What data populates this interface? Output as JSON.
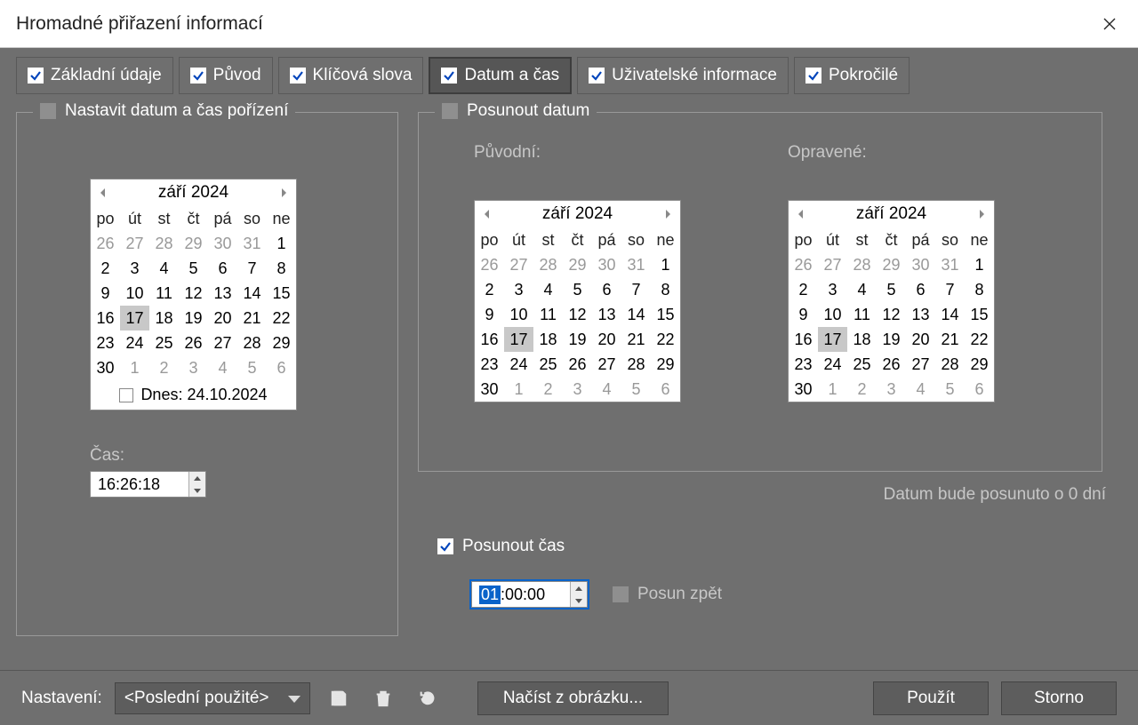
{
  "title": "Hromadné přiřazení informací",
  "tabs": [
    {
      "label": "Základní údaje",
      "checked": true,
      "active": false
    },
    {
      "label": "Původ",
      "checked": true,
      "active": false
    },
    {
      "label": "Klíčová slova",
      "checked": true,
      "active": false
    },
    {
      "label": "Datum a čas",
      "checked": true,
      "active": true
    },
    {
      "label": "Uživatelské informace",
      "checked": true,
      "active": false
    },
    {
      "label": "Pokročilé",
      "checked": true,
      "active": false
    }
  ],
  "group1": {
    "label": "Nastavit datum a čas pořízení",
    "checked": false,
    "cas_label": "Čas:",
    "cas_value": "16:26:18",
    "calendar": {
      "month_year": "září 2024",
      "weekdays": [
        "po",
        "út",
        "st",
        "čt",
        "pá",
        "so",
        "ne"
      ],
      "leading_dim": [
        "26",
        "27",
        "28",
        "29",
        "30",
        "31"
      ],
      "days": [
        "1",
        "2",
        "3",
        "4",
        "5",
        "6",
        "7",
        "8",
        "9",
        "10",
        "11",
        "12",
        "13",
        "14",
        "15",
        "16",
        "17",
        "18",
        "19",
        "20",
        "21",
        "22",
        "23",
        "24",
        "25",
        "26",
        "27",
        "28",
        "29",
        "30"
      ],
      "trailing_dim": [
        "1",
        "2",
        "3",
        "4",
        "5",
        "6"
      ],
      "selected": "17",
      "footer": "Dnes: 24.10.2024"
    }
  },
  "group2": {
    "label": "Posunout datum",
    "checked": false,
    "label_puvodni": "Původní:",
    "label_opravene": "Opravené:",
    "calendar": {
      "month_year": "září 2024",
      "weekdays": [
        "po",
        "út",
        "st",
        "čt",
        "pá",
        "so",
        "ne"
      ],
      "leading_dim": [
        "26",
        "27",
        "28",
        "29",
        "30",
        "31"
      ],
      "days": [
        "1",
        "2",
        "3",
        "4",
        "5",
        "6",
        "7",
        "8",
        "9",
        "10",
        "11",
        "12",
        "13",
        "14",
        "15",
        "16",
        "17",
        "18",
        "19",
        "20",
        "21",
        "22",
        "23",
        "24",
        "25",
        "26",
        "27",
        "28",
        "29",
        "30"
      ],
      "trailing_dim": [
        "1",
        "2",
        "3",
        "4",
        "5",
        "6"
      ],
      "selected": "17"
    },
    "shift_note": "Datum bude posunuto o 0 dní"
  },
  "shift_time": {
    "label": "Posunout čas",
    "checked": true,
    "value_sel": "01",
    "value_rest": ":00:00",
    "back_label": "Posun zpět",
    "back_checked": false
  },
  "bottombar": {
    "nastaveni": "Nastavení:",
    "preset": "<Poslední použité>",
    "load": "Načíst z obrázku...",
    "apply": "Použít",
    "cancel": "Storno"
  }
}
